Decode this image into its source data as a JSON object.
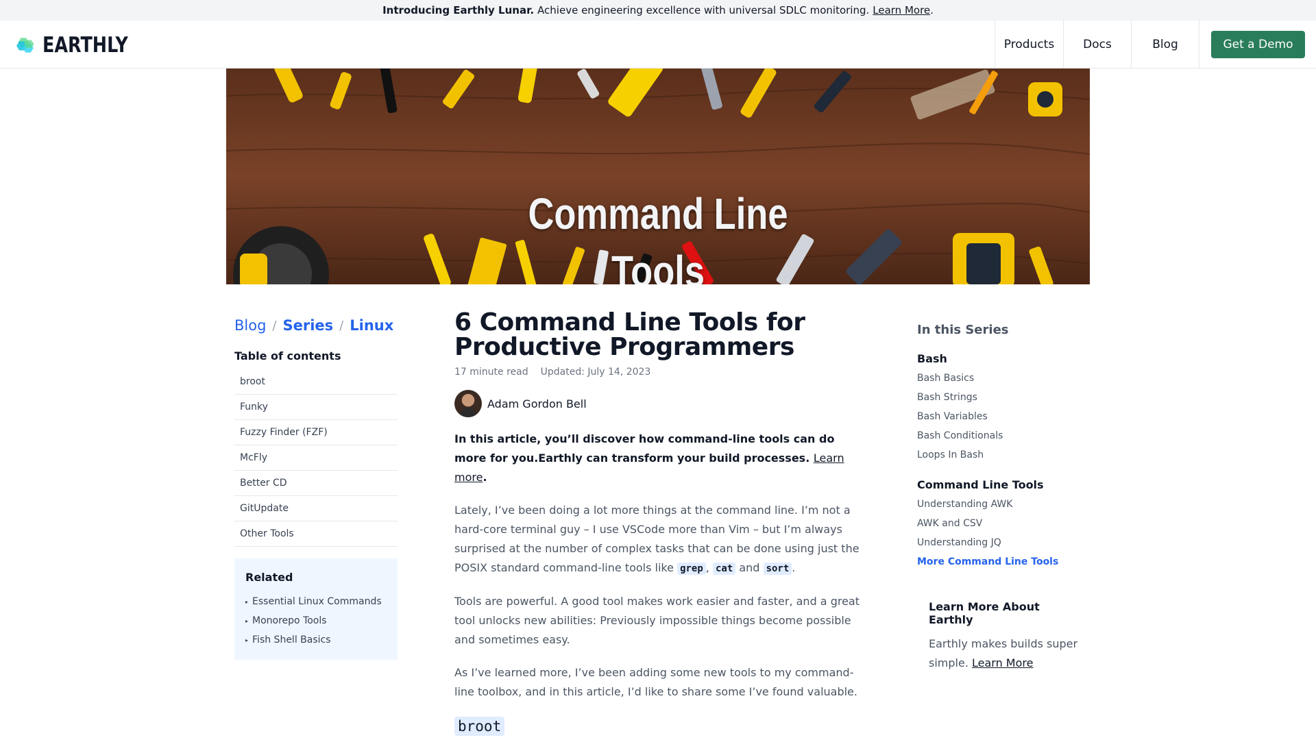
{
  "announcement": {
    "bold": "Introducing Earthly Lunar.",
    "text": "Achieve engineering excellence with universal SDLC monitoring.",
    "link": "Learn More",
    "end": "."
  },
  "header": {
    "logo_text": "EARTHLY",
    "nav": {
      "products": "Products",
      "docs": "Docs",
      "blog": "Blog"
    },
    "cta": "Get a Demo",
    "cta_color": "#2a7d5b"
  },
  "hero": {
    "line1": "Command Line",
    "line2": "Tools"
  },
  "breadcrumb": {
    "blog": "Blog",
    "series": "Series",
    "linux": "Linux",
    "sep": "/"
  },
  "toc": {
    "title": "Table of contents",
    "items": [
      "broot",
      "Funky",
      "Fuzzy Finder (FZF)",
      "McFly",
      "Better CD",
      "GitUpdate",
      "Other Tools"
    ]
  },
  "related": {
    "title": "Related",
    "items": [
      "Essential Linux Commands",
      "Monorepo Tools",
      "Fish Shell Basics"
    ]
  },
  "article": {
    "title_line1": "6 Command Line Tools for",
    "title_line2": "Productive Programmers",
    "read_time": "17 minute read",
    "updated": "Updated: July 14, 2023",
    "author": "Adam Gordon Bell",
    "intro_bold": "In this article, you’ll discover how command-line tools can do more for you.Earthly can transform your build processes.",
    "intro_link": "Learn more",
    "intro_end": ".",
    "p1_text": "Lately, I’ve been doing a lot more things at the command line. I’m not a hard-core terminal guy – I use VSCode more than Vim – but I’m always surprised at the number of complex tasks that can be done using just the POSIX standard command-line tools like",
    "p1_code1": "grep",
    "p1_comma": ",",
    "p1_code2": "cat",
    "p1_and": "and",
    "p1_code3": "sort",
    "p1_end": ".",
    "p2": "Tools are powerful. A good tool makes work easier and faster, and a great tool unlocks new abilities: Previously impossible things become possible and sometimes easy.",
    "p3": "As I’ve learned more, I’ve been adding some new tools to my command-line toolbox, and in this article, I’d like to share some I’ve found valuable.",
    "section_heading": "broot"
  },
  "series": {
    "title": "In this Series",
    "bash_title": "Bash",
    "bash_items": [
      "Bash Basics",
      "Bash Strings",
      "Bash Variables",
      "Bash Conditionals",
      "Loops In Bash"
    ],
    "cli_title": "Command Line Tools",
    "cli_items": [
      "Understanding AWK",
      "AWK and CSV",
      "Understanding JQ",
      "More Command Line Tools"
    ]
  },
  "learn_more": {
    "title": "Learn More About Earthly",
    "text": "Earthly makes builds super simple.",
    "link": "Learn More"
  }
}
